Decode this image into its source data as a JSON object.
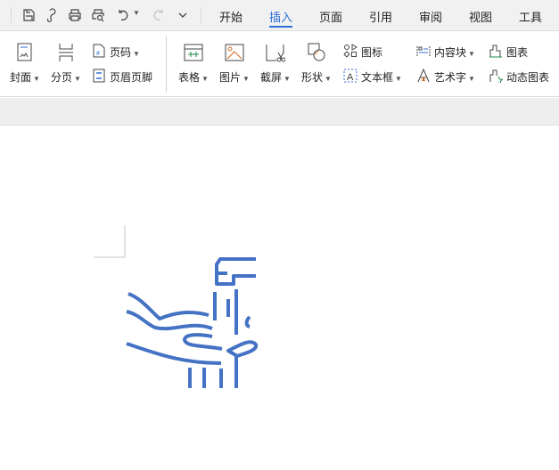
{
  "quick_access": [
    "save-icon",
    "format-painter-icon",
    "print-icon",
    "print-preview-icon",
    "undo-icon",
    "redo-icon",
    "more-icon"
  ],
  "tabs": [
    {
      "label": "开始"
    },
    {
      "label": "插入",
      "active": true
    },
    {
      "label": "页面"
    },
    {
      "label": "引用"
    },
    {
      "label": "审阅"
    },
    {
      "label": "视图"
    },
    {
      "label": "工具"
    }
  ],
  "ribbon": {
    "cover": "封面",
    "page_break": "分页",
    "page_number": "页码",
    "header_footer": "页眉页脚",
    "table": "表格",
    "picture": "图片",
    "screenshot": "截屏",
    "shape": "形状",
    "icon": "图标",
    "textbox": "文本框",
    "content_block": "内容块",
    "wordart": "艺术字",
    "chart": "图表",
    "dynamic_chart": "动态图表"
  },
  "colors": {
    "accent": "#2f6fd6",
    "illustration": "#4472c4"
  }
}
